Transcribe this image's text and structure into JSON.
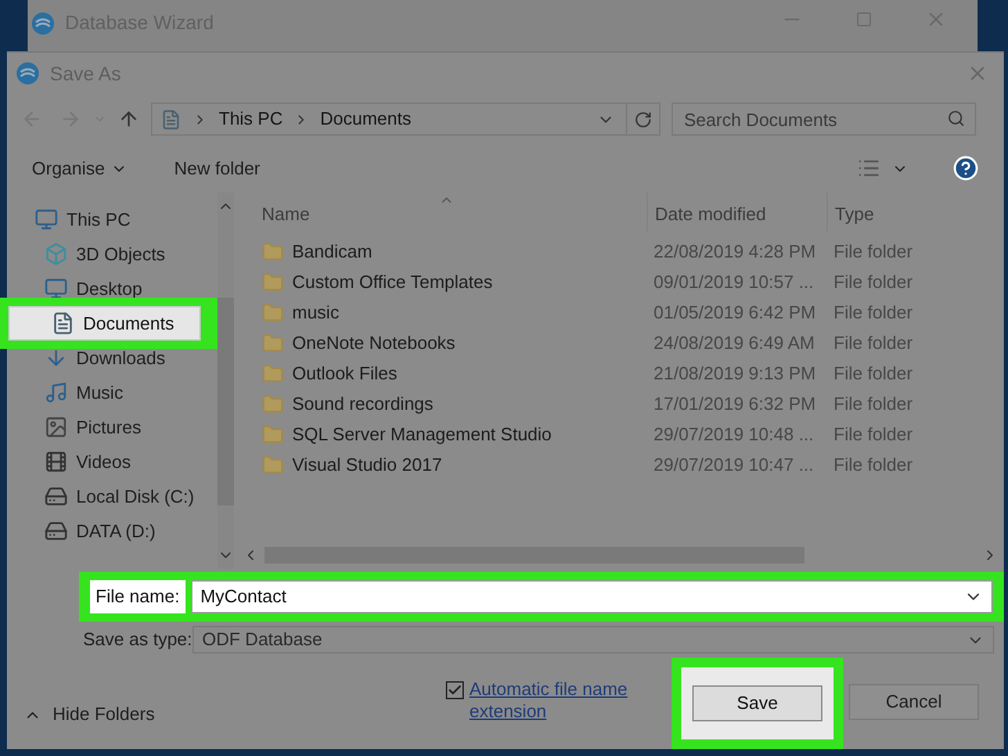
{
  "background_window": {
    "title": "Database Wizard"
  },
  "dialog": {
    "title": "Save As"
  },
  "address_bar": {
    "path": [
      "This PC",
      "Documents"
    ]
  },
  "search": {
    "placeholder": "Search Documents"
  },
  "toolbar": {
    "organise": "Organise",
    "new_folder": "New folder"
  },
  "sidebar": {
    "items": [
      {
        "label": "This PC",
        "kind": "pc",
        "selected": false,
        "children": [
          {
            "label": "3D Objects",
            "kind": "cube",
            "selected": false
          },
          {
            "label": "Desktop",
            "kind": "desktop",
            "selected": false
          },
          {
            "label": "Documents",
            "kind": "document",
            "selected": true
          },
          {
            "label": "Downloads",
            "kind": "download",
            "selected": false
          },
          {
            "label": "Music",
            "kind": "music",
            "selected": false
          },
          {
            "label": "Pictures",
            "kind": "picture",
            "selected": false
          },
          {
            "label": "Videos",
            "kind": "video",
            "selected": false
          },
          {
            "label": "Local Disk (C:)",
            "kind": "disk",
            "selected": false
          },
          {
            "label": "DATA (D:)",
            "kind": "drive",
            "selected": false
          }
        ]
      }
    ]
  },
  "table": {
    "columns": [
      "Name",
      "Date modified",
      "Type"
    ],
    "rows": [
      {
        "name": "Bandicam",
        "date": "22/08/2019 4:28 PM",
        "type": "File folder"
      },
      {
        "name": "Custom Office Templates",
        "date": "09/01/2019 10:57 ...",
        "type": "File folder"
      },
      {
        "name": "music",
        "date": "01/05/2019 6:42 PM",
        "type": "File folder"
      },
      {
        "name": "OneNote Notebooks",
        "date": "24/08/2019 6:49 AM",
        "type": "File folder"
      },
      {
        "name": "Outlook Files",
        "date": "21/08/2019 9:13 PM",
        "type": "File folder"
      },
      {
        "name": "Sound recordings",
        "date": "17/01/2019 6:32 PM",
        "type": "File folder"
      },
      {
        "name": "SQL Server Management Studio",
        "date": "29/07/2019 10:48 ...",
        "type": "File folder"
      },
      {
        "name": "Visual Studio 2017",
        "date": "29/07/2019 10:47 ...",
        "type": "File folder"
      }
    ]
  },
  "file_name": {
    "label": "File name:",
    "value": "MyContact",
    "highlighted": true
  },
  "save_as_type": {
    "label": "Save as type:",
    "value": "ODF Database"
  },
  "hide_folders": "Hide Folders",
  "auto_extension": {
    "label": "Automatic file name extension",
    "checked": true
  },
  "buttons": {
    "save": {
      "label": "Save",
      "highlighted": true
    },
    "cancel": {
      "label": "Cancel"
    }
  }
}
